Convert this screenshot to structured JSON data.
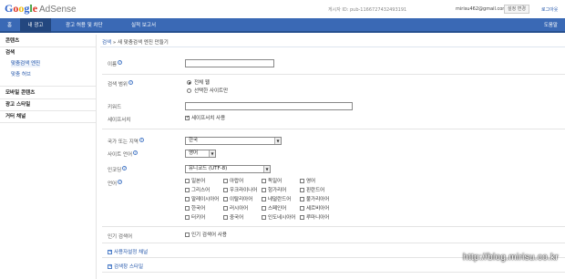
{
  "header": {
    "logo_parts": [
      "G",
      "o",
      "o",
      "g",
      "l",
      "e"
    ],
    "product": "AdSense",
    "publisher_id": "게시자 ID: pub-1166727432493191",
    "email": "mirisu462@gmail.com",
    "settings_button": "설정 변경",
    "logout": "로그아웃"
  },
  "nav": {
    "items": [
      "홈",
      "내 광고",
      "광고 허용 및 차단",
      "실적 보고서"
    ],
    "help": "도움말"
  },
  "sidebar": {
    "content": "콘텐츠",
    "search": "검색",
    "search_engine": "맞춤검색 엔진",
    "search_other": "맞춤 허브",
    "mobile": "모바일 콘텐츠",
    "ad_style": "광고 스타일",
    "channels": "거터 채널"
  },
  "breadcrumb": {
    "link": "검색",
    "current": "» 새 맞춤검색 엔진 만들기"
  },
  "form": {
    "name_label": "이름",
    "scope_label": "검색 범위",
    "scope_options": [
      "전체 웹",
      "선택한 사이트만"
    ],
    "keyword_label": "키워드",
    "safesearch_label": "세이프서치",
    "safesearch_check": "세이프서치 사용",
    "country_label": "국가 또는 지역",
    "country_value": "한국",
    "site_lang_label": "사이트 언어",
    "site_lang_value": "영어",
    "encoding_label": "인코딩",
    "encoding_value": "유니코드 (UTF-8)",
    "language_label": "언어",
    "languages": [
      [
        "일본어",
        "아랍어",
        "독일어",
        "영어"
      ],
      [
        "그리스어",
        "우크라이나어",
        "헝가리어",
        "핀란드어"
      ],
      [
        "말레이시아어",
        "이탈리아어",
        "네덜란드어",
        "불가리아어"
      ],
      [
        "한국어",
        "러시아어",
        "스페인어",
        "세르비아어"
      ],
      [
        "터키어",
        "중국어",
        "인도네시아어",
        "루마니아어"
      ]
    ],
    "popular_label": "인기 검색어",
    "popular_check": "인기 검색어 사용",
    "expand_1": "사용자설정 채널",
    "expand_2": "검색창 스타일"
  },
  "watermark": "http://blog.mirisu.co.kr"
}
